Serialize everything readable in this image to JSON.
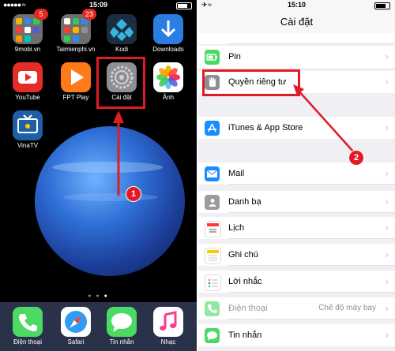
{
  "left": {
    "status": {
      "time": "15:09"
    },
    "apps": [
      {
        "name": "9mobi.vn",
        "badge": "5"
      },
      {
        "name": "Taimienphi.vn",
        "badge": "23"
      },
      {
        "name": "Kodi",
        "badge": ""
      },
      {
        "name": "Downloads",
        "badge": ""
      },
      {
        "name": "YouTube",
        "badge": ""
      },
      {
        "name": "FPT Play",
        "badge": ""
      },
      {
        "name": "Cài đặt",
        "badge": ""
      },
      {
        "name": "Ảnh",
        "badge": ""
      },
      {
        "name": "VinaTV",
        "badge": ""
      }
    ],
    "dock": [
      {
        "name": "Điện thoại"
      },
      {
        "name": "Safari"
      },
      {
        "name": "Tin nhắn"
      },
      {
        "name": "Nhạc"
      }
    ],
    "step": "1"
  },
  "right": {
    "status": {
      "time": "15:10"
    },
    "title": "Cài đặt",
    "rows": [
      {
        "label": "Pin",
        "value": "",
        "icon": "battery-icon",
        "color": "#4cd964"
      },
      {
        "label": "Quyền riêng tư",
        "value": "",
        "icon": "hand-icon",
        "color": "#8e8e93"
      },
      {
        "label": "iTunes & App Store",
        "value": "",
        "icon": "app-store-icon",
        "color": "#1a8cff"
      },
      {
        "label": "Mail",
        "value": "",
        "icon": "mail-icon",
        "color": "#1a8cff"
      },
      {
        "label": "Danh bạ",
        "value": "",
        "icon": "contacts-icon",
        "color": "#9b9b9b"
      },
      {
        "label": "Lịch",
        "value": "",
        "icon": "calendar-icon",
        "color": "#ffffff"
      },
      {
        "label": "Ghi chú",
        "value": "",
        "icon": "notes-icon",
        "color": "#ffcc00"
      },
      {
        "label": "Lời nhắc",
        "value": "",
        "icon": "reminders-icon",
        "color": "#ffffff"
      },
      {
        "label": "Điện thoại",
        "value": "Chế độ máy bay",
        "icon": "phone-icon",
        "color": "#4cd964"
      },
      {
        "label": "Tin nhắn",
        "value": "",
        "icon": "messages-icon",
        "color": "#4cd964"
      }
    ],
    "step": "2"
  },
  "colors": {
    "highlight": "#e01b24"
  }
}
